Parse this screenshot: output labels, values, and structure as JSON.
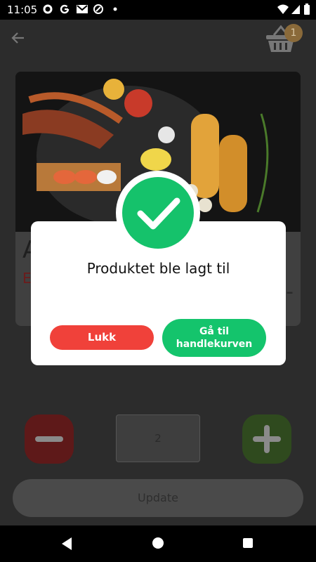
{
  "status_bar": {
    "time": "11:05",
    "icons": [
      "gear-icon",
      "google-g-icon",
      "gmail-icon",
      "data-saver-icon",
      "dot-icon",
      "wifi-icon",
      "signal-icon",
      "battery-icon"
    ]
  },
  "header": {
    "cart_badge_count": "1"
  },
  "product": {
    "name_visible": "A",
    "description_visible": "E p",
    "price_visible": "-"
  },
  "quantity": {
    "value": "2"
  },
  "update_button_label": "Update",
  "dialog": {
    "message": "Produktet ble lagt til",
    "close_label": "Lukk",
    "cart_label_line1": "Gå til",
    "cart_label_line2": "handlekurven"
  },
  "colors": {
    "success_green": "#15c26b",
    "close_red": "#f0413a",
    "background": "#2c2c2c"
  }
}
